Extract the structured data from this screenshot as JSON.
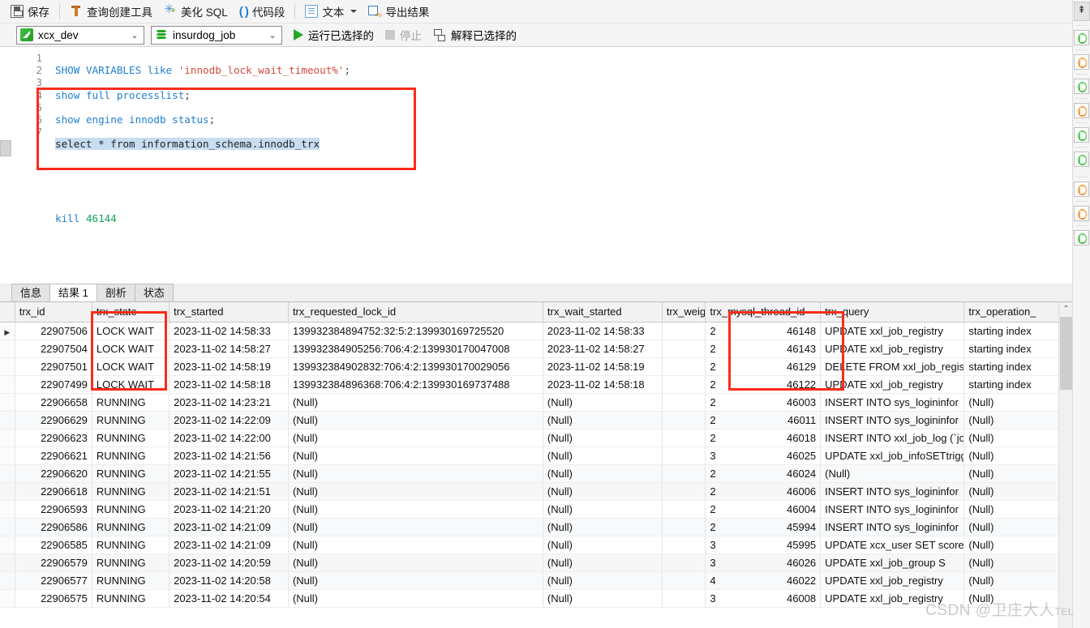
{
  "toolbar": {
    "items": [
      {
        "icon": "save-icon",
        "label": "保存"
      },
      {
        "icon": "query-builder-icon",
        "label": "查询创建工具"
      },
      {
        "icon": "beautify-sql-icon",
        "label": "美化 SQL"
      },
      {
        "icon": "code-snippet-icon",
        "label": "代码段"
      },
      {
        "icon": "text-doc-icon",
        "label": "文本"
      },
      {
        "icon": "export-result-icon",
        "label": "导出结果"
      }
    ],
    "code_snippet_glyph": "( )"
  },
  "selector": {
    "connection": {
      "icon": "connection-icon",
      "value": "xcx_dev",
      "arrow": "⌄"
    },
    "database": {
      "icon": "database-icon",
      "value": "insurdog_job",
      "arrow": "⌄"
    },
    "run_selected": "运行已选择的",
    "stop": "停止",
    "explain_selected": "解释已选择的"
  },
  "editor": {
    "line_numbers": [
      "1",
      "2",
      "3",
      "4",
      "5",
      "6",
      "7"
    ],
    "lines": [
      {
        "n": 1,
        "text": "SHOW VARIABLES like 'innodb_lock_wait_timeout%';"
      },
      {
        "n": 2,
        "text": "show full processlist;"
      },
      {
        "n": 3,
        "text": "show engine innodb status;"
      },
      {
        "n": 4,
        "text": "select * from information_schema.innodb_trx",
        "selected": true
      },
      {
        "n": 5,
        "text": ""
      },
      {
        "n": 6,
        "text": ""
      },
      {
        "n": 7,
        "text": "kill 46144"
      }
    ],
    "tokens": {
      "l1_kw1": "SHOW",
      "l1_kw2": "VARIABLES",
      "l1_kw3": "like",
      "l1_str": "'innodb_lock_wait_timeout%'",
      "l1_end": ";",
      "l2_kw1": "show",
      "l2_kw2": "full",
      "l2_kw3": "processlist",
      "l2_end": ";",
      "l3_kw1": "show",
      "l3_kw2": "engine",
      "l3_kw3": "innodb",
      "l3_kw4": "status",
      "l3_end": ";",
      "l4_text": "select * from information_schema.innodb_trx",
      "l7_kw": "kill",
      "l7_num": "46144"
    }
  },
  "results": {
    "tabs": [
      {
        "label": "信息",
        "active": false
      },
      {
        "label": "结果 1",
        "active": true
      },
      {
        "label": "剖析",
        "active": false
      },
      {
        "label": "状态",
        "active": false
      }
    ],
    "columns": [
      "trx_id",
      "trx_state",
      "trx_started",
      "trx_requested_lock_id",
      "trx_wait_started",
      "trx_weight",
      "trx_mysql_thread_id",
      "trx_query",
      "trx_operation_"
    ],
    "null_text": "(Null)",
    "row_marker": "▶",
    "rows": [
      {
        "marker": true,
        "trx_id": "22907506",
        "trx_state": "LOCK WAIT",
        "trx_started": "2023-11-02 14:58:33",
        "trx_requested_lock_id": "139932384894752:32:5:2:139930169725520",
        "trx_wait_started": "2023-11-02 14:58:33",
        "trx_weight": "",
        "trx_mysql_thread_id": "2",
        "trx_thread": "46148",
        "trx_query": "UPDATE xxl_job_registry",
        "trx_operation": "starting index"
      },
      {
        "marker": false,
        "trx_id": "22907504",
        "trx_state": "LOCK WAIT",
        "trx_started": "2023-11-02 14:58:27",
        "trx_requested_lock_id": "139932384905256:706:4:2:139930170047008",
        "trx_wait_started": "2023-11-02 14:58:27",
        "trx_weight": "",
        "trx_mysql_thread_id": "2",
        "trx_thread": "46143",
        "trx_query": "UPDATE xxl_job_registry",
        "trx_operation": "starting index"
      },
      {
        "marker": false,
        "trx_id": "22907501",
        "trx_state": "LOCK WAIT",
        "trx_started": "2023-11-02 14:58:19",
        "trx_requested_lock_id": "139932384902832:706:4:2:139930170029056",
        "trx_wait_started": "2023-11-02 14:58:19",
        "trx_weight": "",
        "trx_mysql_thread_id": "2",
        "trx_thread": "46129",
        "trx_query": "DELETE FROM xxl_job_registr",
        "trx_operation": "starting index"
      },
      {
        "marker": false,
        "trx_id": "22907499",
        "trx_state": "LOCK WAIT",
        "trx_started": "2023-11-02 14:58:18",
        "trx_requested_lock_id": "139932384896368:706:4:2:139930169737488",
        "trx_wait_started": "2023-11-02 14:58:18",
        "trx_weight": "",
        "trx_mysql_thread_id": "2",
        "trx_thread": "46122",
        "trx_query": "UPDATE xxl_job_registry",
        "trx_operation": "starting index"
      },
      {
        "marker": false,
        "trx_id": "22906658",
        "trx_state": "RUNNING",
        "trx_started": "2023-11-02 14:23:21",
        "trx_requested_lock_id": "(Null)",
        "trx_wait_started": "(Null)",
        "trx_weight": "",
        "trx_mysql_thread_id": "2",
        "trx_thread": "46003",
        "trx_query": "INSERT INTO sys_logininfor",
        "trx_operation": "(Null)"
      },
      {
        "marker": false,
        "trx_id": "22906629",
        "trx_state": "RUNNING",
        "trx_started": "2023-11-02 14:22:09",
        "trx_requested_lock_id": "(Null)",
        "trx_wait_started": "(Null)",
        "trx_weight": "",
        "trx_mysql_thread_id": "2",
        "trx_thread": "46011",
        "trx_query": "INSERT INTO sys_logininfor",
        "trx_operation": "(Null)"
      },
      {
        "marker": false,
        "trx_id": "22906623",
        "trx_state": "RUNNING",
        "trx_started": "2023-11-02 14:22:00",
        "trx_requested_lock_id": "(Null)",
        "trx_wait_started": "(Null)",
        "trx_weight": "",
        "trx_mysql_thread_id": "2",
        "trx_thread": "46018",
        "trx_query": "INSERT INTO xxl_job_log (`jo",
        "trx_operation": "(Null)"
      },
      {
        "marker": false,
        "trx_id": "22906621",
        "trx_state": "RUNNING",
        "trx_started": "2023-11-02 14:21:56",
        "trx_requested_lock_id": "(Null)",
        "trx_wait_started": "(Null)",
        "trx_weight": "",
        "trx_mysql_thread_id": "3",
        "trx_thread": "46025",
        "trx_query": "UPDATE xxl_job_infoSETtrigg",
        "trx_operation": "(Null)"
      },
      {
        "marker": false,
        "trx_id": "22906620",
        "trx_state": "RUNNING",
        "trx_started": "2023-11-02 14:21:55",
        "trx_requested_lock_id": "(Null)",
        "trx_wait_started": "(Null)",
        "trx_weight": "",
        "trx_mysql_thread_id": "2",
        "trx_thread": "46024",
        "trx_query": "(Null)",
        "trx_operation": "(Null)"
      },
      {
        "marker": false,
        "trx_id": "22906618",
        "trx_state": "RUNNING",
        "trx_started": "2023-11-02 14:21:51",
        "trx_requested_lock_id": "(Null)",
        "trx_wait_started": "(Null)",
        "trx_weight": "",
        "trx_mysql_thread_id": "2",
        "trx_thread": "46006",
        "trx_query": "INSERT INTO sys_logininfor",
        "trx_operation": "(Null)"
      },
      {
        "marker": false,
        "trx_id": "22906593",
        "trx_state": "RUNNING",
        "trx_started": "2023-11-02 14:21:20",
        "trx_requested_lock_id": "(Null)",
        "trx_wait_started": "(Null)",
        "trx_weight": "",
        "trx_mysql_thread_id": "2",
        "trx_thread": "46004",
        "trx_query": "INSERT INTO sys_logininfor",
        "trx_operation": "(Null)"
      },
      {
        "marker": false,
        "trx_id": "22906586",
        "trx_state": "RUNNING",
        "trx_started": "2023-11-02 14:21:09",
        "trx_requested_lock_id": "(Null)",
        "trx_wait_started": "(Null)",
        "trx_weight": "",
        "trx_mysql_thread_id": "2",
        "trx_thread": "45994",
        "trx_query": "INSERT INTO sys_logininfor",
        "trx_operation": "(Null)"
      },
      {
        "marker": false,
        "trx_id": "22906585",
        "trx_state": "RUNNING",
        "trx_started": "2023-11-02 14:21:09",
        "trx_requested_lock_id": "(Null)",
        "trx_wait_started": "(Null)",
        "trx_weight": "",
        "trx_mysql_thread_id": "3",
        "trx_thread": "45995",
        "trx_query": "UPDATE xcx_user SET score =",
        "trx_operation": "(Null)"
      },
      {
        "marker": false,
        "trx_id": "22906579",
        "trx_state": "RUNNING",
        "trx_started": "2023-11-02 14:20:59",
        "trx_requested_lock_id": "(Null)",
        "trx_wait_started": "(Null)",
        "trx_weight": "",
        "trx_mysql_thread_id": "3",
        "trx_thread": "46026",
        "trx_query": "UPDATE xxl_job_group          S",
        "trx_operation": "(Null)"
      },
      {
        "marker": false,
        "trx_id": "22906577",
        "trx_state": "RUNNING",
        "trx_started": "2023-11-02 14:20:58",
        "trx_requested_lock_id": "(Null)",
        "trx_wait_started": "(Null)",
        "trx_weight": "",
        "trx_mysql_thread_id": "4",
        "trx_thread": "46022",
        "trx_query": "UPDATE xxl_job_registry",
        "trx_operation": "(Null)"
      },
      {
        "marker": false,
        "trx_id": "22906575",
        "trx_state": "RUNNING",
        "trx_started": "2023-11-02 14:20:54",
        "trx_requested_lock_id": "(Null)",
        "trx_wait_started": "(Null)",
        "trx_weight": "",
        "trx_mysql_thread_id": "3",
        "trx_thread": "46008",
        "trx_query": "UPDATE xxl_job_registry",
        "trx_operation": "(Null)"
      }
    ]
  },
  "annotations": {
    "box_editor": "highlight-editor-statement",
    "box_trx_state": "highlight-trx-state-column",
    "box_thread_id": "highlight-trx-mysql-thread-id-column",
    "accent_color": "#fc2b19"
  },
  "right_dock": {
    "top_icon": "collapse-panel-icon",
    "items": [
      {
        "icon": "connection-green-icon"
      },
      {
        "icon": "connection-orange-icon"
      },
      {
        "icon": "connection-green-icon"
      },
      {
        "icon": "connection-orange-icon"
      },
      {
        "icon": "connection-green-icon"
      },
      {
        "icon": "connection-green-icon"
      },
      {
        "icon": "connection-orange-icon"
      },
      {
        "icon": "connection-orange-icon"
      },
      {
        "icon": "connection-green-icon"
      }
    ]
  },
  "watermark": {
    "text": "CSDN @卫庄大人",
    "suffix": "TEL"
  },
  "scrollbar": {
    "up_arrow": "⌃"
  }
}
